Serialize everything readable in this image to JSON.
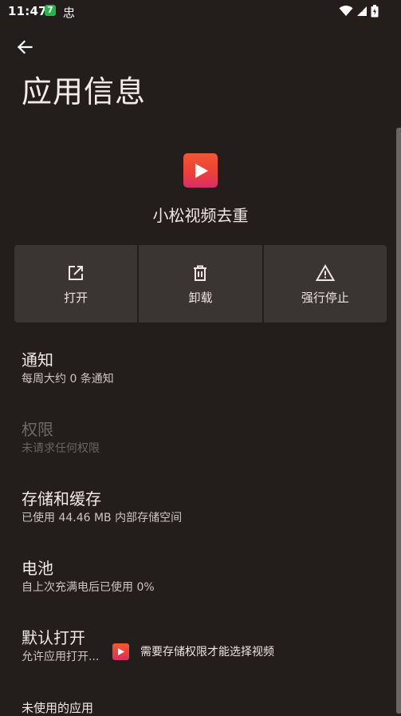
{
  "status_bar": {
    "time": "11:47",
    "app_badge": "7",
    "notif_glyph": "忠"
  },
  "header": {
    "title": "应用信息"
  },
  "app": {
    "name": "小松视频去重"
  },
  "actions": [
    {
      "label": "打开",
      "icon": "open-external-icon"
    },
    {
      "label": "卸载",
      "icon": "trash-icon"
    },
    {
      "label": "强行停止",
      "icon": "warning-icon"
    }
  ],
  "prefs": {
    "notifications": {
      "title": "通知",
      "summary": "每周大约 0 条通知"
    },
    "permissions": {
      "title": "权限",
      "summary": "未请求任何权限"
    },
    "storage": {
      "title": "存储和缓存",
      "summary": "已使用 44.46 MB 内部存储空间"
    },
    "battery": {
      "title": "电池",
      "summary": "自上次充满电后已使用 0%"
    },
    "open_by_default": {
      "title": "默认打开",
      "summary": "允许应用打开..."
    },
    "unused_apps": {
      "title": "未使用的应用"
    }
  },
  "toast": {
    "text": "需要存储权限才能选择视频"
  },
  "colors": {
    "background": "#231d1c",
    "button_surface": "#3a3532",
    "brand_red": "#ee4037",
    "brand_pink": "#d92e6a"
  }
}
